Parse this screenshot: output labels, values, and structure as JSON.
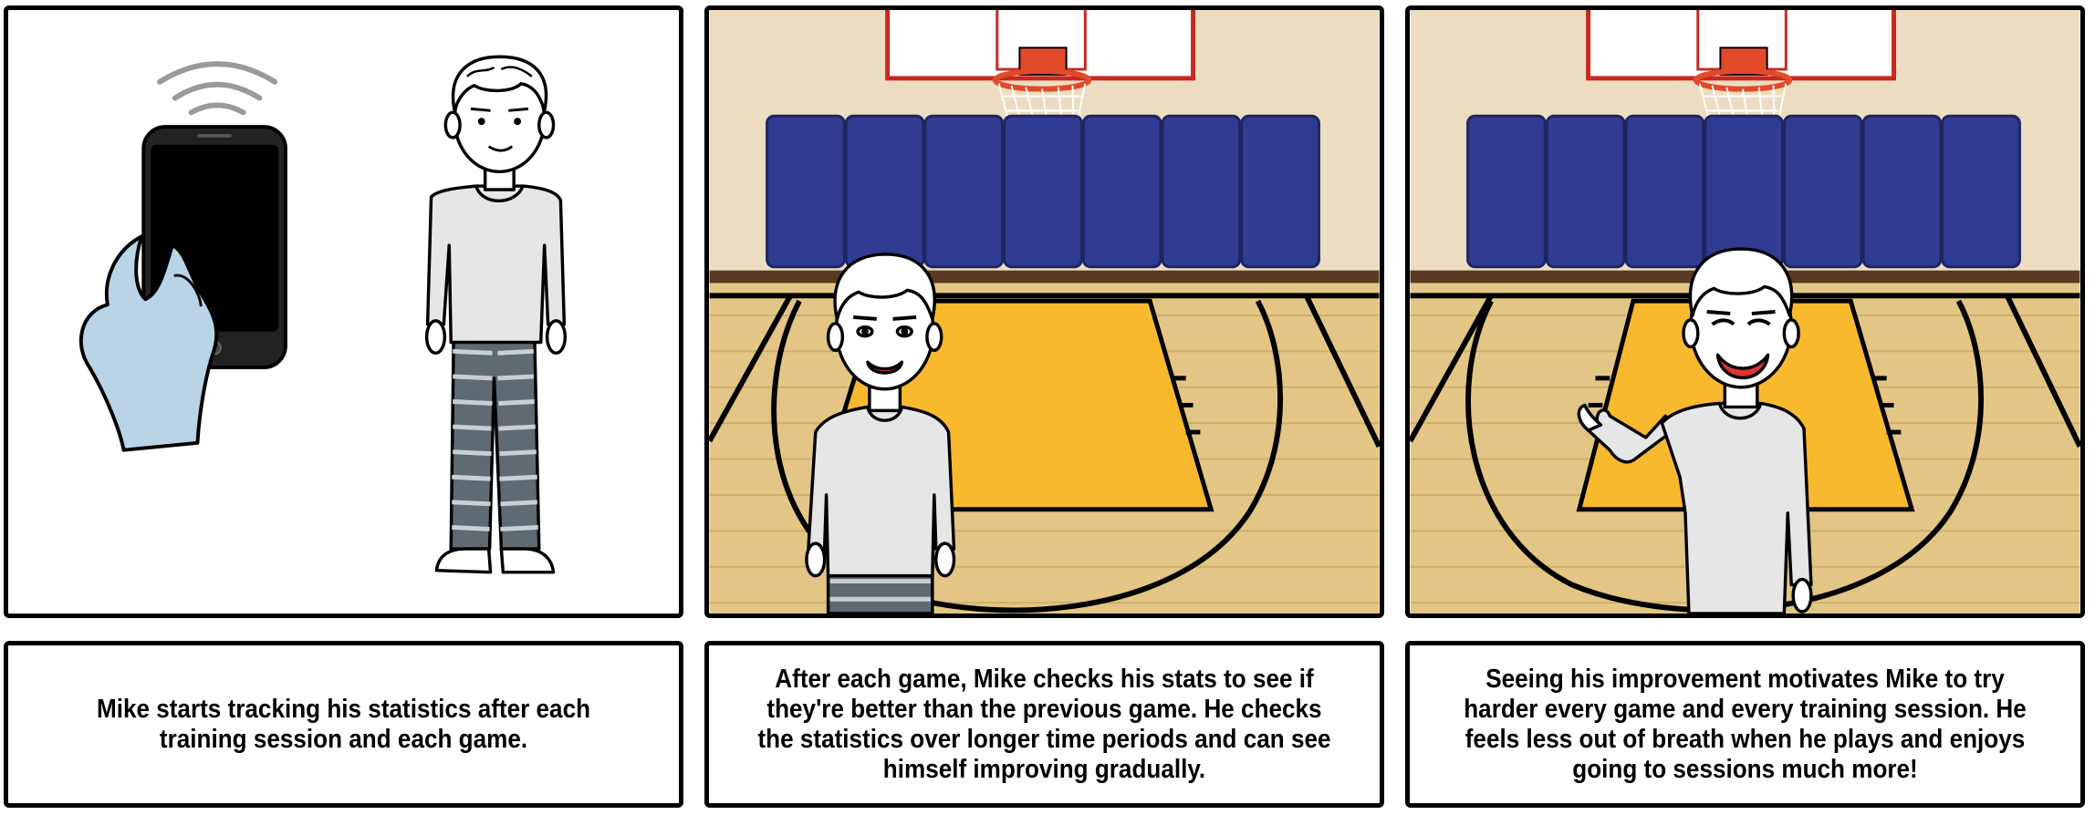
{
  "panels": [
    {
      "scene": "white",
      "caption": "Mike starts tracking his statistics after each training session and each game."
    },
    {
      "scene": "gym",
      "caption": "After each game, Mike checks his stats to see if they're better than the previous game. He checks the statistics over longer time periods and can see himself improving gradually."
    },
    {
      "scene": "gym",
      "caption": "Seeing his improvement motivates Mike to try harder every game and every training session. He feels less out of breath when he plays and enjoys going to sessions much more!"
    }
  ],
  "colors": {
    "wall": "#ecdcc2",
    "mats": "#2f3c91",
    "floor": "#e3c686",
    "key": "#f9b92f",
    "rim": "#e24a2a",
    "shirt": "#e6e6e6",
    "pants": "#5f6a72",
    "hand": "#b9d4e6"
  }
}
